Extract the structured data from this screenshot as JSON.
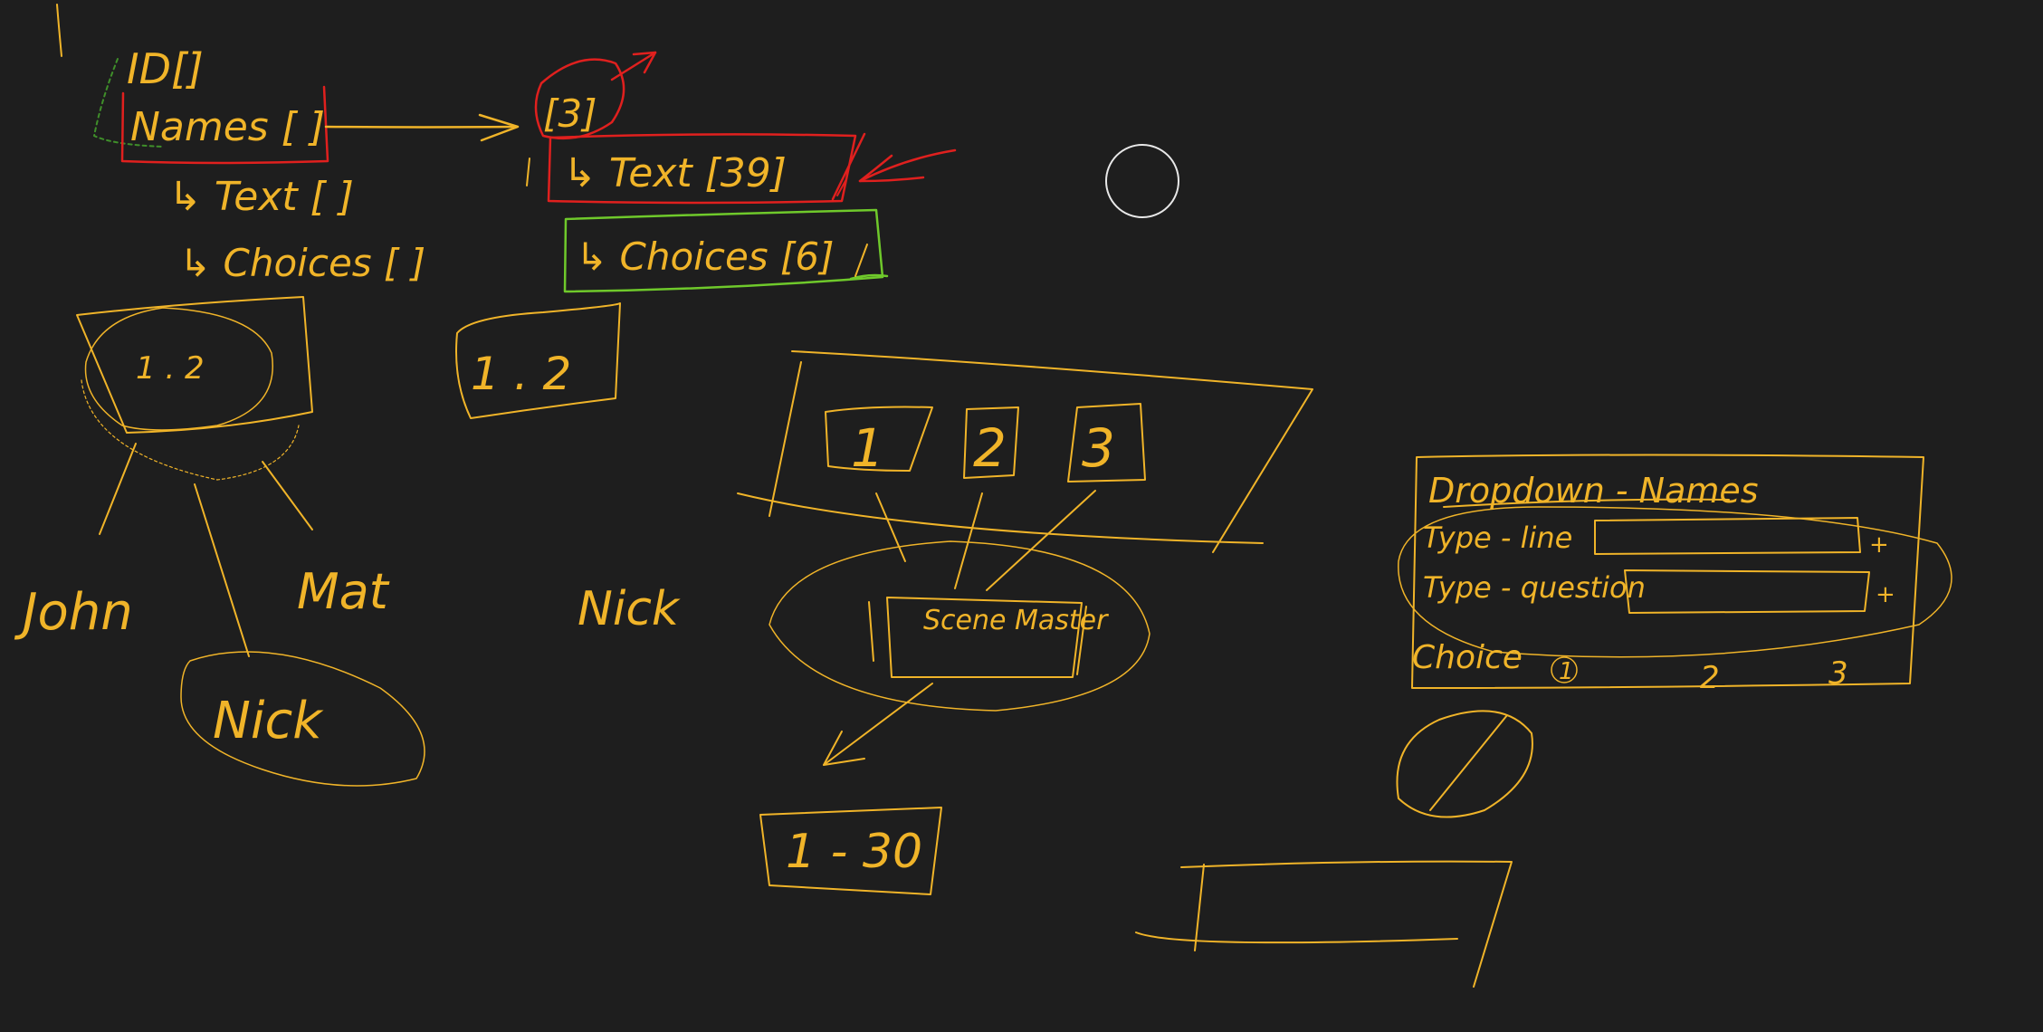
{
  "canvas": {
    "background": "#1e1e1e"
  },
  "colors": {
    "ink": "#f0b429",
    "red": "#e0201e",
    "green": "#6fc92b",
    "cursor": "#e8e8e8",
    "green_dark": "#3f8f2a"
  },
  "labels": {
    "id": "ID[]",
    "names": "Names [ ]",
    "text_left": "↳ Text [ ]",
    "choices_left": "↳ Choices [ ]",
    "three": "[3]",
    "text_right": "↳ Text [39]",
    "choices_right": "↳ Choices [6]",
    "one_two_a": "1 . 2",
    "one_two_b": "1 . 2",
    "john": "John",
    "mat": "Mat",
    "nick_circle": "Nick",
    "nick_mid": "Nick",
    "box_1": "1",
    "box_2": "2",
    "box_3": "3",
    "scene_master": "Scene Master",
    "range": "1 - 30",
    "dropdown_title": "Dropdown - Names",
    "type_line": "Type - line",
    "type_question": "Type - question",
    "choice": "Choice",
    "choice_1": "1",
    "choice_2": "2",
    "choice_3": "3",
    "plus_1": "+",
    "plus_2": "+"
  }
}
